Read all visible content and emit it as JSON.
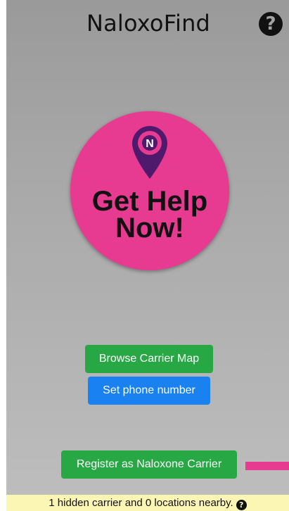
{
  "app": {
    "title": "NaloxoFind"
  },
  "help": {
    "icon": "?"
  },
  "get_help": {
    "line1": "Get Help",
    "line2": "Now!",
    "logo_letter": "N"
  },
  "buttons": {
    "browse": "Browse Carrier Map",
    "phone": "Set phone number",
    "register": "Register as Naloxone Carrier"
  },
  "status": {
    "text": "1 hidden carrier and 0 locations nearby.",
    "icon": "?"
  },
  "colors": {
    "accent": "#e63b90",
    "green": "#28a745",
    "blue": "#1a82f0",
    "status_bg": "#fbf6b4"
  },
  "icons": {
    "help": "question-circle-icon",
    "logo": "naloxone-pin-icon"
  }
}
